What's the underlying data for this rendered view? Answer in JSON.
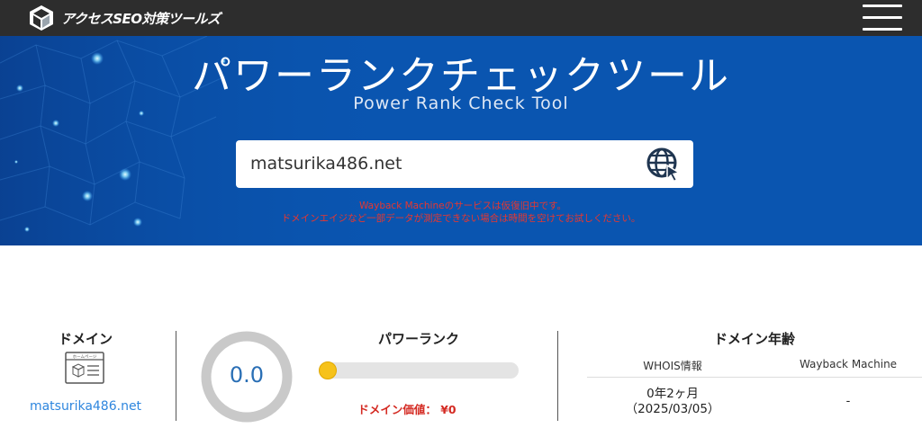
{
  "header": {
    "logo_text": "アクセスSEO対策ツールズ",
    "menu_icon": "hamburger-menu-icon"
  },
  "hero": {
    "title": "パワーランクチェックツール",
    "subtitle": "Power Rank Check Tool",
    "search_value": "matsurika486.net",
    "search_button_icon": "globe-cursor-icon",
    "notice_line1": "Wayback Machineのサービスは仮復旧中です。",
    "notice_line2": "ドメインエイジなど一部データが測定できない場合は時間を空けてお試しください。",
    "colors": {
      "background": "#0a55b0",
      "notice": "#e8372f"
    }
  },
  "results": {
    "domain": {
      "heading": "ドメイン",
      "icon": "homepage-icon",
      "icon_label": "ホームページ",
      "value": "matsurika486.net"
    },
    "power_rank": {
      "score": "0.0",
      "heading": "パワーランク",
      "slider_level": 0,
      "value_text": "ドメイン価値： ¥0"
    },
    "domain_age": {
      "heading": "ドメイン年齢",
      "col_whois": "WHOIS情報",
      "col_wayback": "Wayback Machine",
      "whois_age": "0年2ヶ月",
      "whois_date": "（2025/03/05）",
      "wayback_value": "-"
    }
  }
}
